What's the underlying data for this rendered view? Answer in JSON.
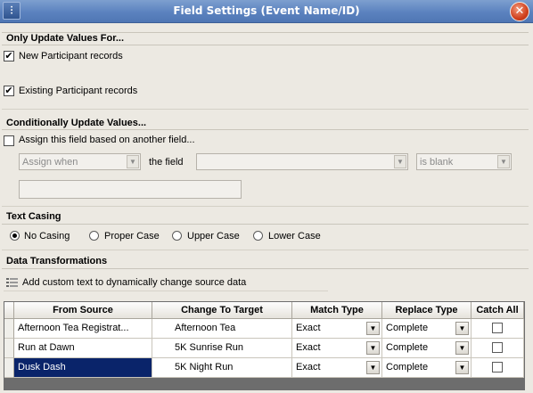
{
  "window": {
    "icon": "sliders-icon",
    "title": "Field Settings (Event Name/ID)",
    "close_icon": "close-icon"
  },
  "only_update": {
    "title": "Only Update Values For...",
    "new_participant": {
      "label": "New Participant records",
      "checked": true,
      "mark": "✔"
    },
    "existing_participant": {
      "label": "Existing Participant records",
      "checked": true,
      "mark": "✔"
    }
  },
  "conditional": {
    "title": "Conditionally Update Values...",
    "assign_label": "Assign this field based on another field...",
    "assign_checked": false,
    "assign_when": "Assign when",
    "the_field_label": "the field",
    "field_value": "",
    "condition": "is blank",
    "value_text": ""
  },
  "text_casing": {
    "title": "Text Casing",
    "options": [
      "No Casing",
      "Proper Case",
      "Upper Case",
      "Lower Case"
    ],
    "selected": "No Casing"
  },
  "transformations": {
    "title": "Data Transformations",
    "add_text_label": "Add custom text to dynamically change source data",
    "columns": [
      "From Source",
      "Change To Target",
      "Match Type",
      "Replace Type",
      "Catch All"
    ],
    "rows": [
      {
        "from": "Afternoon Tea Registrat...",
        "to": "Afternoon Tea",
        "match": "Exact",
        "replace": "Complete",
        "catch_all": false
      },
      {
        "from": "Run at Dawn",
        "to": "5K Sunrise Run",
        "match": "Exact",
        "replace": "Complete",
        "catch_all": false
      },
      {
        "from": "Dusk Dash",
        "to": "5K Night Run",
        "match": "Exact",
        "replace": "Complete",
        "catch_all": false
      }
    ],
    "selected_row": 2
  },
  "colors": {
    "title_bar": "#5b82bf",
    "selection": "#0a246a",
    "window_bg": "#ece9e2"
  }
}
